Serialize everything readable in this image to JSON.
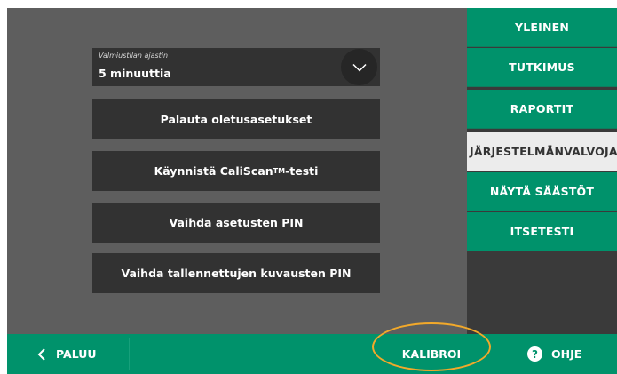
{
  "dropdown": {
    "label": "Valmiustilan ajastin",
    "value": "5 minuuttia"
  },
  "buttons": {
    "reset": "Palauta oletusasetukset",
    "caliscan_prefix": "Käynnistä CaliScan",
    "caliscan_tm": "TM",
    "caliscan_suffix": "-testi",
    "change_settings_pin": "Vaihda asetusten PIN",
    "change_images_pin": "Vaihda tallennettujen kuvausten PIN"
  },
  "sidebar": {
    "items": [
      {
        "label": "YLEINEN"
      },
      {
        "label": "TUTKIMUS"
      },
      {
        "label": "RAPORTIT"
      },
      {
        "label": "JÄRJESTELMÄNVALVOJA"
      },
      {
        "label": "NÄYTÄ SÄÄSTÖT"
      },
      {
        "label": "ITSETESTI"
      }
    ],
    "active_index": 3
  },
  "bottom_bar": {
    "back_label": "PALUU",
    "calibrate_label": "KALIBROI",
    "help_label": "OHJE",
    "help_icon_glyph": "?"
  },
  "colors": {
    "accent": "#00926b",
    "highlight": "#f2a92a",
    "panel": "#5e5e5e",
    "button": "#323232"
  }
}
